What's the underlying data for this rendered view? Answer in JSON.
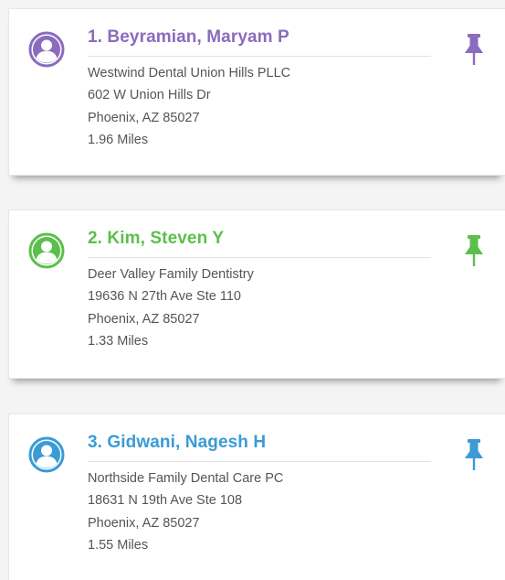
{
  "colors": {
    "purple": "#8a6bbd",
    "green": "#5cbf4b",
    "blue": "#3a9bd6"
  },
  "icons": {
    "avatar": "user-circle-icon",
    "pin": "pushpin-icon"
  },
  "results": [
    {
      "name": "1. Beyramian, Maryam P",
      "practice": "Westwind Dental Union Hills PLLC",
      "street": "602 W Union Hills Dr",
      "city": "Phoenix, AZ 85027",
      "distance": "1.96 Miles",
      "color": "#8a6bbd"
    },
    {
      "name": "2. Kim, Steven Y",
      "practice": "Deer Valley Family Dentistry",
      "street": "19636 N 27th Ave Ste 110",
      "city": "Phoenix, AZ 85027",
      "distance": "1.33 Miles",
      "color": "#5cbf4b"
    },
    {
      "name": "3. Gidwani, Nagesh H",
      "practice": "Northside Family Dental Care PC",
      "street": "18631 N 19th Ave Ste 108",
      "city": "Phoenix, AZ 85027",
      "distance": "1.55 Miles",
      "color": "#3a9bd6"
    }
  ]
}
